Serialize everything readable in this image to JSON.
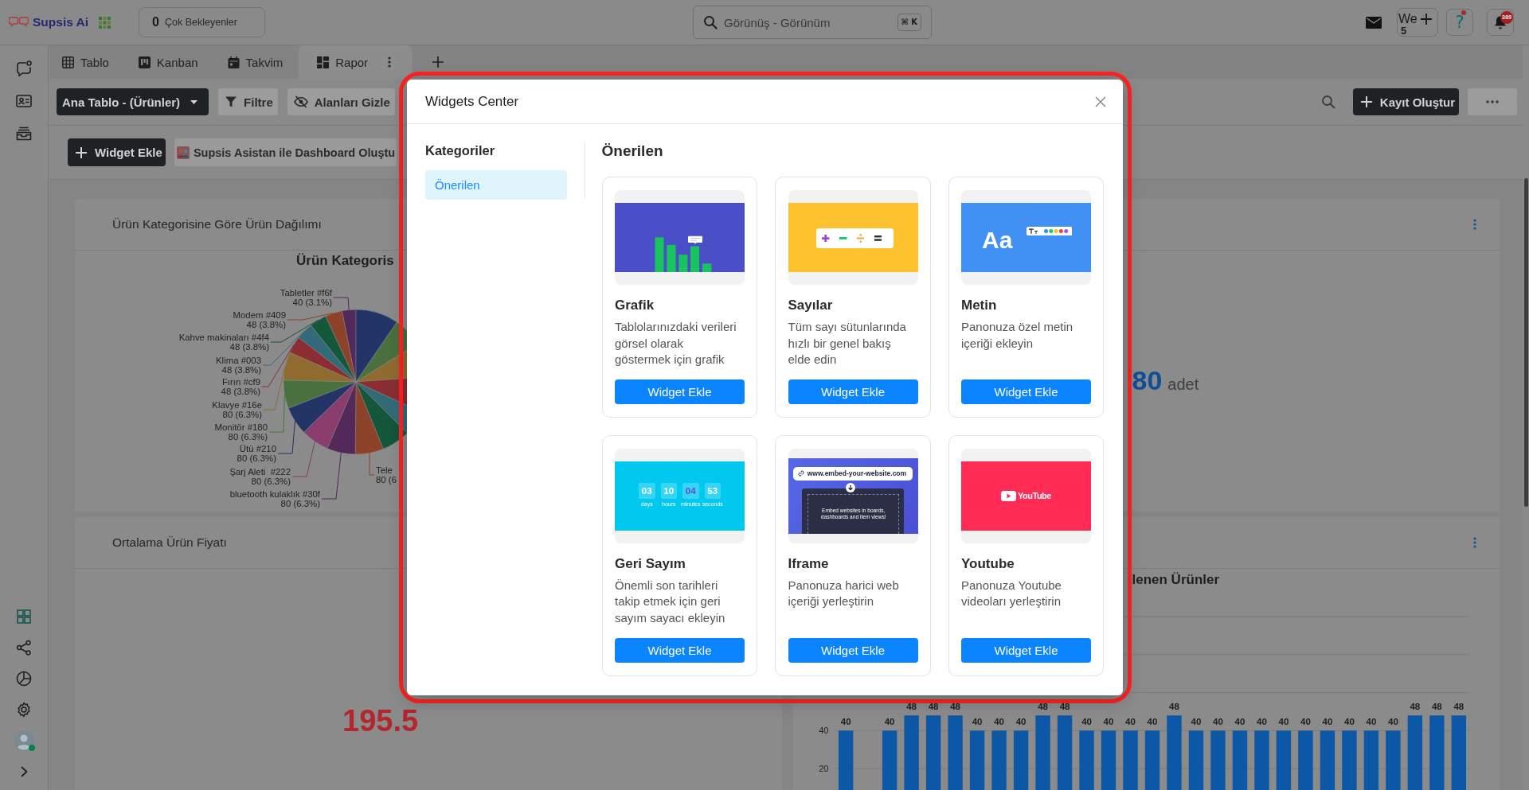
{
  "topbar": {
    "logo": "Supsis Ai",
    "pending": {
      "count": "0",
      "label": "Çok Bekleyenler"
    },
    "search": {
      "placeholder": "Görünüş - Görünüm",
      "shortcut": "⌘ K"
    },
    "account": {
      "initials": "We",
      "count": "5"
    },
    "help": {
      "label": "?",
      "alert": true
    },
    "notifications": {
      "count": "389"
    }
  },
  "sidebar": {
    "user_online": true
  },
  "tabs": [
    {
      "label": "Tablo",
      "kind": "table",
      "selected": false
    },
    {
      "label": "Kanban",
      "kind": "kanban",
      "selected": false
    },
    {
      "label": "Takvim",
      "kind": "calendar",
      "selected": false
    },
    {
      "label": "Rapor",
      "kind": "report",
      "selected": true
    }
  ],
  "toolbar": {
    "table_select": "Ana Tablo - (Ürünler)",
    "filter": "Filtre",
    "hide_fields": "Alanları Gizle",
    "create": "Kayıt Oluştur"
  },
  "dashboard_actions": {
    "add_widget": "Widget Ekle",
    "assistant": "Supsis Asistan ile Dashboard Oluştu"
  },
  "widgets": [
    {
      "kind": "pie",
      "title": "Ürün Kategorisine Göre Ürün Dağılımı",
      "chart_title": "Ürün Kategoris",
      "slices": [
        {
          "label": "Tabletler #f6f",
          "value": "40 (3.1%)",
          "color": "#51295a"
        },
        {
          "label": "Modem #409",
          "value": "48 (3.8%)",
          "color": "#8d432a"
        },
        {
          "label": "Kahve makinaları #4f4",
          "value": "48 (3.8%)",
          "color": "#14573a"
        },
        {
          "label": "Klima #003",
          "value": "48 (3.8%)",
          "color": "#336a7a"
        },
        {
          "label": "Fırın #cf9",
          "value": "48 (3.8%)",
          "color": "#8b2e33"
        },
        {
          "label": "Klavye #16e",
          "value": "80 (6.3%)",
          "color": "#8f6b30"
        },
        {
          "label": "Monitör #180",
          "value": "80 (6.3%)",
          "color": "#4a703f"
        },
        {
          "label": "Ütü #210",
          "value": "80 (6.3%)",
          "color": "#233567"
        },
        {
          "label": "Şarj Aleti  #222",
          "value": "80 (6.3%)",
          "color": "#8a3c6c"
        },
        {
          "label": "Tele",
          "value": "80 (6",
          "color": "#8d432a"
        },
        {
          "label": "bluetooth kulaklık #30f",
          "value": "80 (6.3%)",
          "color": "#522958"
        },
        {
          "color": "#233567"
        },
        {
          "color": "#4a703f"
        },
        {
          "color": "#8f6b30"
        },
        {
          "color": "#8b2e33"
        },
        {
          "color": "#336a7a"
        },
        {
          "color": "#14573a"
        }
      ]
    },
    {
      "kind": "number",
      "menu": true,
      "value": "80",
      "unit": "adet"
    },
    {
      "kind": "price",
      "title": "Ortalama Ürün Fiyatı",
      "value": "195.5"
    },
    {
      "kind": "bar",
      "menu": true,
      "chart_data": {
        "type": "bar",
        "title": "lenen Ürünler",
        "values": [
          40,
          null,
          40,
          48,
          48,
          48,
          40,
          40,
          40,
          48,
          48,
          40,
          40,
          40,
          40,
          48,
          40,
          40,
          40,
          40,
          40,
          40,
          40,
          40,
          40,
          40,
          48,
          48,
          48
        ],
        "ylim": [
          0,
          100
        ],
        "yticks": [
          20,
          40
        ],
        "data_labels": true
      }
    }
  ],
  "modal": {
    "title": "Widgets Center",
    "highlighted": true,
    "categories_heading": "Kategoriler",
    "categories": [
      {
        "label": "Önerilen",
        "selected": true
      }
    ],
    "section_title": "Önerilen",
    "widgets": [
      {
        "kind": "chart",
        "title": "Grafik",
        "description": "Tablolarınızdaki verileri\ngörsel olarak\ngöstermek için grafik",
        "button": "Widget Ekle"
      },
      {
        "kind": "numbers",
        "title": "Sayılar",
        "description": "Tüm sayı sütunlarında\nhızlı bir genel bakış\nelde edin",
        "button": "Widget Ekle"
      },
      {
        "kind": "text",
        "title": "Metin",
        "description": "Panonuza özel metin\niçeriği ekleyin",
        "button": "Widget Ekle",
        "preview": {
          "sample": "Aa"
        }
      },
      {
        "kind": "countdown",
        "title": "Geri Sayım",
        "description": "Önemli son tarihleri\ntakip etmek için geri\nsayım sayacı ekleyin",
        "button": "Widget Ekle",
        "preview": {
          "units": [
            {
              "value": "03",
              "label": "days",
              "highlighted": false
            },
            {
              "value": "10",
              "label": "hours",
              "highlighted": false
            },
            {
              "value": "04",
              "label": "minutes",
              "highlighted": true
            },
            {
              "value": "53",
              "label": "seconds",
              "highlighted": false
            }
          ]
        }
      },
      {
        "kind": "iframe",
        "title": "Iframe",
        "description": "Panonuza harici web\niçeriği yerleştirin",
        "button": "Widget Ekle",
        "preview": {
          "url": "www.embed-your-website.com",
          "caption": "Embed websites in boards,\ndashboards and item views!"
        }
      },
      {
        "kind": "youtube",
        "title": "Youtube",
        "description": "Panonuza Youtube\nvideoları yerleştirin",
        "button": "Widget Ekle",
        "preview": {
          "logo": "YouTube"
        }
      }
    ]
  }
}
